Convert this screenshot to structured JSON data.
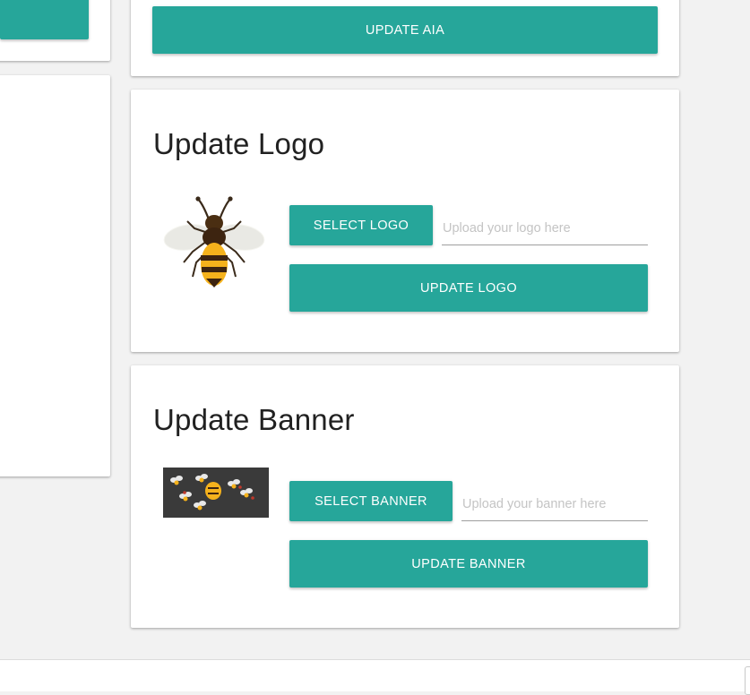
{
  "aia_section": {
    "update_button_label": "UPDATE AIA"
  },
  "logo_section": {
    "title": "Update Logo",
    "select_button_label": "SELECT LOGO",
    "file_placeholder": "Upload your logo here",
    "update_button_label": "UPDATE LOGO",
    "preview_image": "bee-logo"
  },
  "banner_section": {
    "title": "Update Banner",
    "select_button_label": "SELECT BANNER",
    "file_placeholder": "Upload your banner here",
    "update_button_label": "UPDATE BANNER",
    "preview_image": "bees-and-hive-banner"
  },
  "colors": {
    "accent": "#26a69a",
    "background": "#f2f2f2",
    "card": "#ffffff"
  }
}
